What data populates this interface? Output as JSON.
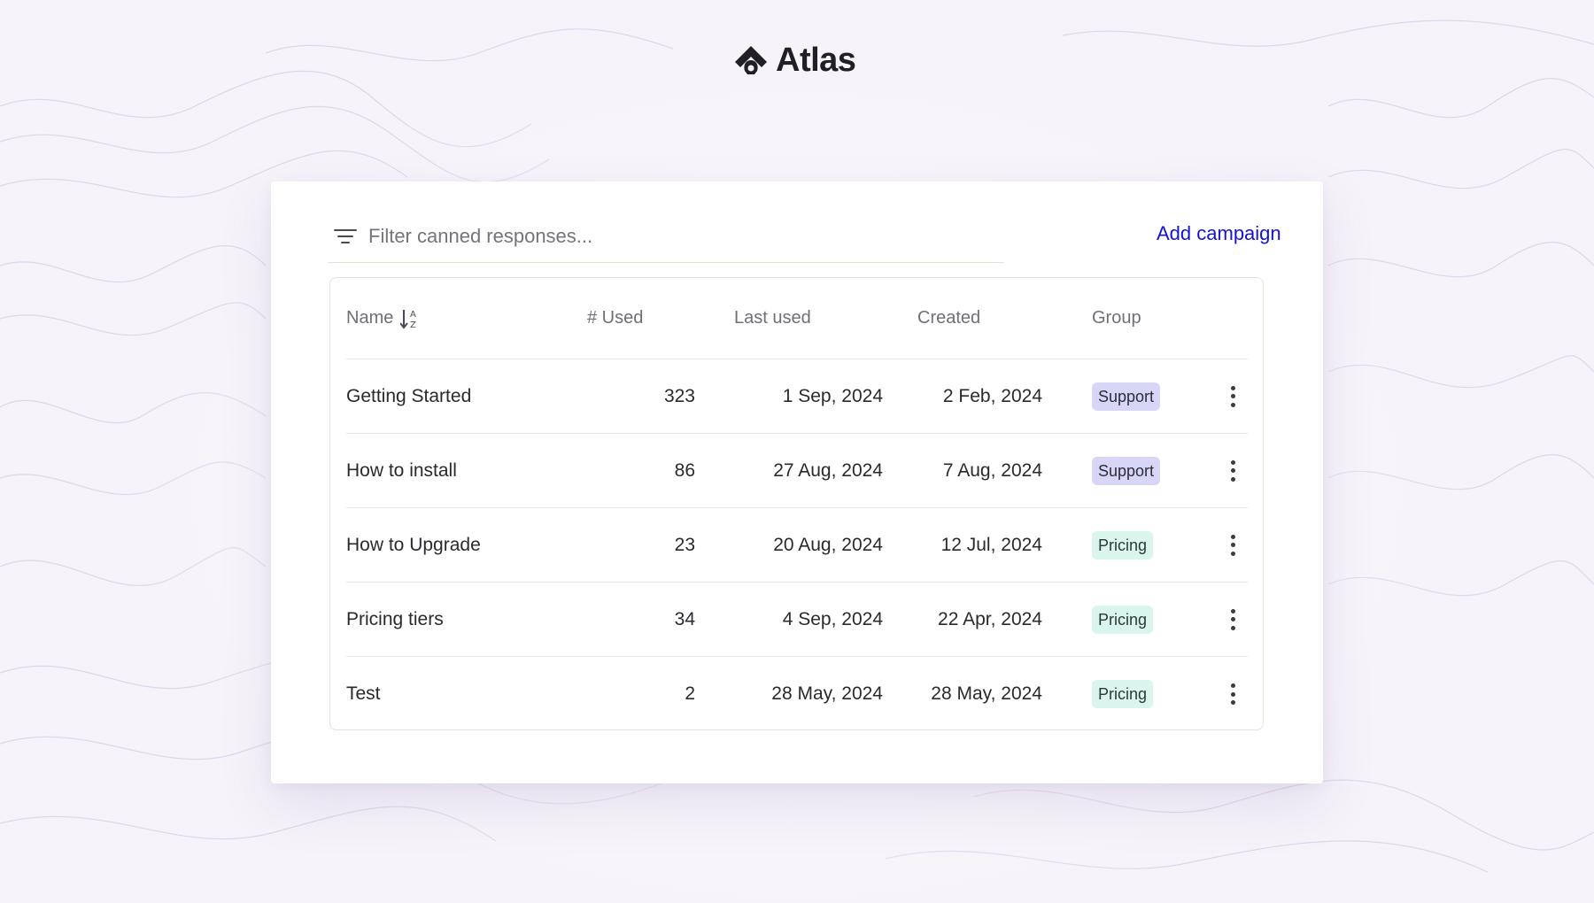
{
  "brand": {
    "name": "Atlas"
  },
  "filter": {
    "placeholder": "Filter canned responses..."
  },
  "actions": {
    "add_label": "Add campaign"
  },
  "table": {
    "headers": {
      "name": "Name",
      "used": "# Used",
      "last_used": "Last used",
      "created": "Created",
      "group": "Group"
    },
    "sort": {
      "column": "Name",
      "direction": "A-Z"
    },
    "rows": [
      {
        "name": "Getting Started",
        "used": "323",
        "last_used": "1 Sep, 2024",
        "created": "2 Feb, 2024",
        "group": "Support"
      },
      {
        "name": "How to install",
        "used": "86",
        "last_used": "27 Aug, 2024",
        "created": "7 Aug, 2024",
        "group": "Support"
      },
      {
        "name": "How to Upgrade",
        "used": "23",
        "last_used": "20 Aug, 2024",
        "created": "12 Jul, 2024",
        "group": "Pricing"
      },
      {
        "name": "Pricing tiers",
        "used": "34",
        "last_used": "4 Sep, 2024",
        "created": "22 Apr, 2024",
        "group": "Pricing"
      },
      {
        "name": "Test",
        "used": "2",
        "last_used": "28 May, 2024",
        "created": "28 May, 2024",
        "group": "Pricing"
      }
    ]
  },
  "colors": {
    "accent": "#1313d6",
    "support_badge": "#d8d6f7",
    "pricing_badge": "#d9f5ee",
    "background": "#f6f3fa"
  },
  "icons": {
    "logo": "atlas-logo-icon",
    "filter": "filter-icon",
    "sort": "sort-alpha-icon",
    "row_menu": "more-vertical-icon"
  }
}
